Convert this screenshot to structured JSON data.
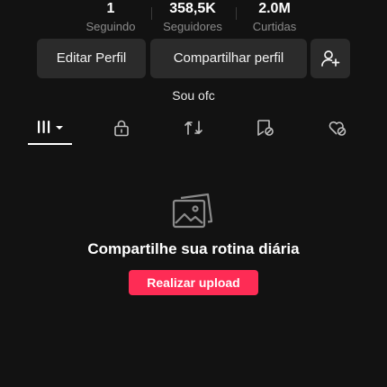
{
  "stats": {
    "following": {
      "value": "1",
      "label": "Seguindo"
    },
    "followers": {
      "value": "358,5K",
      "label": "Seguidores"
    },
    "likes": {
      "value": "2.0M",
      "label": "Curtidas"
    }
  },
  "actions": {
    "edit_profile": "Editar Perfil",
    "share_profile": "Compartilhar perfil",
    "add_friend_icon": "person-add-icon"
  },
  "bio": "Sou ofc",
  "tabs": [
    {
      "id": "videos",
      "icon": "grid-icon",
      "active": true
    },
    {
      "id": "private",
      "icon": "lock-icon",
      "active": false
    },
    {
      "id": "reposts",
      "icon": "repost-icon",
      "active": false
    },
    {
      "id": "favorites",
      "icon": "bookmark-icon",
      "active": false
    },
    {
      "id": "liked",
      "icon": "heart-hidden-icon",
      "active": false
    }
  ],
  "empty_state": {
    "icon": "image-placeholder-icon",
    "title": "Compartilhe sua rotina diária",
    "button": "Realizar upload"
  },
  "colors": {
    "background": "#121212",
    "button_bg": "#2b2b2b",
    "accent": "#fe2c55",
    "muted_text": "#8a8a8a"
  }
}
